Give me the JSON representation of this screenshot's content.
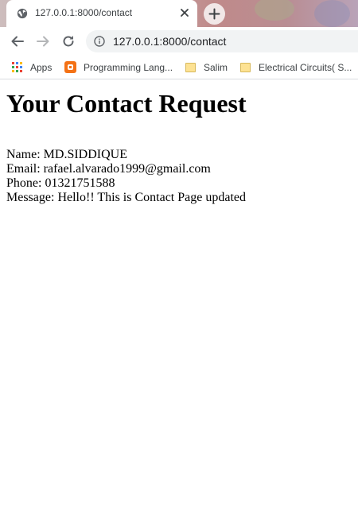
{
  "browser": {
    "tab": {
      "title": "127.0.0.1:8000/contact"
    },
    "address_bar": {
      "url": "127.0.0.1:8000/contact"
    },
    "bookmarks": [
      {
        "label": "Apps",
        "icon": "apps-grid-icon"
      },
      {
        "label": "Programming Lang...",
        "icon": "blogger-icon"
      },
      {
        "label": "Salim",
        "icon": "folder-icon"
      },
      {
        "label": "Electrical Circuits( S...",
        "icon": "folder-icon"
      }
    ]
  },
  "page": {
    "heading": "Your Contact Request",
    "fields": [
      {
        "label": "Name:",
        "value": "MD.SIDDIQUE"
      },
      {
        "label": "Email:",
        "value": "rafael.alvarado1999@gmail.com"
      },
      {
        "label": "Phone:",
        "value": "01321751588"
      },
      {
        "label": "Message:",
        "value": "Hello!! This is Contact Page updated"
      }
    ]
  },
  "colors": {
    "blogger_orange": "#f47216",
    "folder_yellow": "#fde293",
    "tab_text": "#3c4043"
  }
}
